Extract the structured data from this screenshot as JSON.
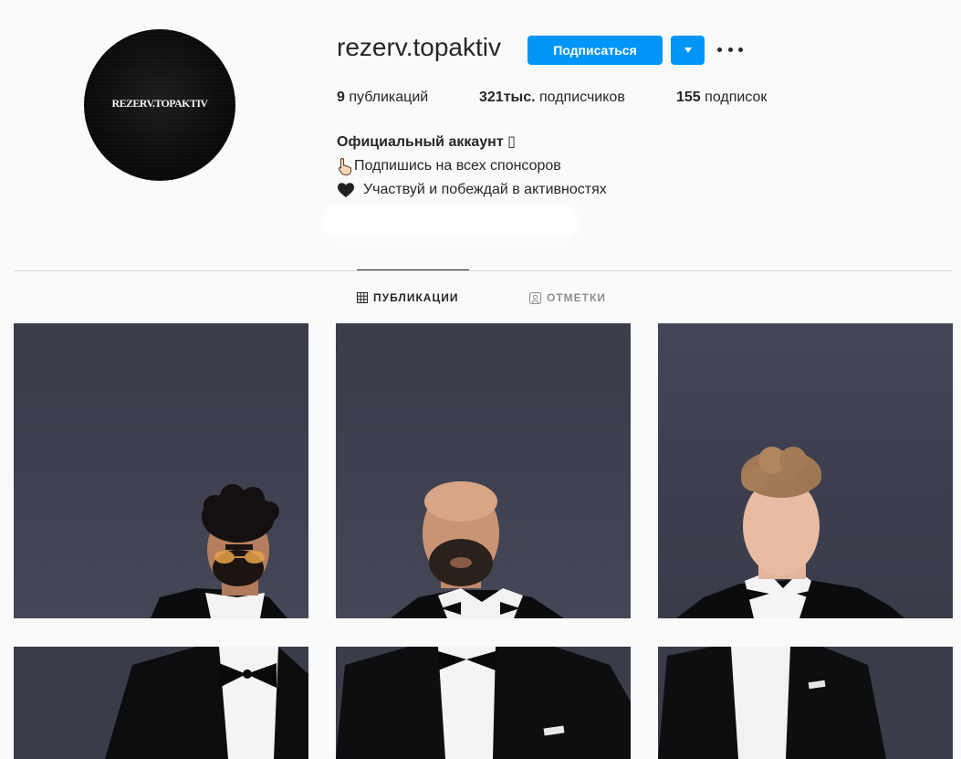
{
  "profile": {
    "avatar_text": "REZERV.TOPAKTIV",
    "username": "rezerv.topaktiv",
    "follow_label": "Подписаться"
  },
  "stats": {
    "posts_count": "9",
    "posts_label": "публикаций",
    "followers_count": "321тыс.",
    "followers_label": "подписчиков",
    "following_count": "155",
    "following_label": "подписок"
  },
  "bio": {
    "name": "Официальный аккаунт ▯",
    "line1": "Подпишись на всех спонсоров",
    "line2": "Участвуй и побеждай в активностях"
  },
  "tabs": [
    {
      "label": "ПУБЛИКАЦИИ",
      "active": true,
      "icon": "grid-icon"
    },
    {
      "label": "ОТМЕТКИ",
      "active": false,
      "icon": "tagged-person-icon"
    }
  ],
  "posts": [
    {
      "subject": "man with curly hair, orange glasses and beard in tuxedo"
    },
    {
      "subject": "bald bearded man in tuxedo"
    },
    {
      "subject": "young man with curly hair in tuxedo"
    },
    {
      "subject": "tuxedo with bow tie"
    },
    {
      "subject": "tuxedo with bow tie and pocket square"
    },
    {
      "subject": "tuxedo with pocket square"
    }
  ],
  "colors": {
    "accent": "#0095f6",
    "text": "#262626",
    "muted": "#8e8e8e",
    "background": "#fafafa",
    "divider": "#dbdbdb"
  }
}
